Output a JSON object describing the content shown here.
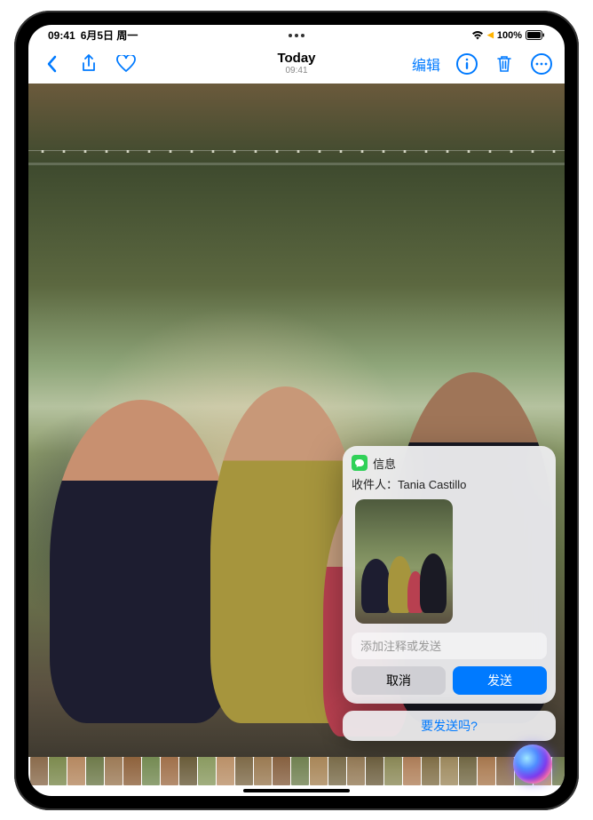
{
  "status": {
    "time": "09:41",
    "date": "6月5日 周一",
    "battery_percent": "100%"
  },
  "nav": {
    "title": "Today",
    "subtitle": "09:41",
    "edit_label": "编辑"
  },
  "siri": {
    "app_label": "信息",
    "recipient_label": "收件人：",
    "recipient_name": "Tania Castillo",
    "comment_placeholder": "添加注释或发送",
    "cancel_label": "取消",
    "send_label": "发送",
    "confirm_label": "要发送吗?"
  },
  "thumbnails": {
    "colors": [
      "#8a6b4c",
      "#7c8a4e",
      "#b58860",
      "#6e7a4a",
      "#9c7a56",
      "#8e623c",
      "#748a52",
      "#a0704a",
      "#6a5c3a",
      "#8a9a60",
      "#ba9068",
      "#7e6a48",
      "#9a7a52",
      "#866040",
      "#708050",
      "#a88658",
      "#7a6c4a",
      "#947a56",
      "#6e6040",
      "#8c8a58",
      "#b0805a",
      "#827048",
      "#9e8a5e",
      "#746a46",
      "#aa7a50",
      "#8a6b4c",
      "#7c8a4e",
      "#b58860",
      "#6e7a4a",
      "#9c7a56"
    ]
  }
}
